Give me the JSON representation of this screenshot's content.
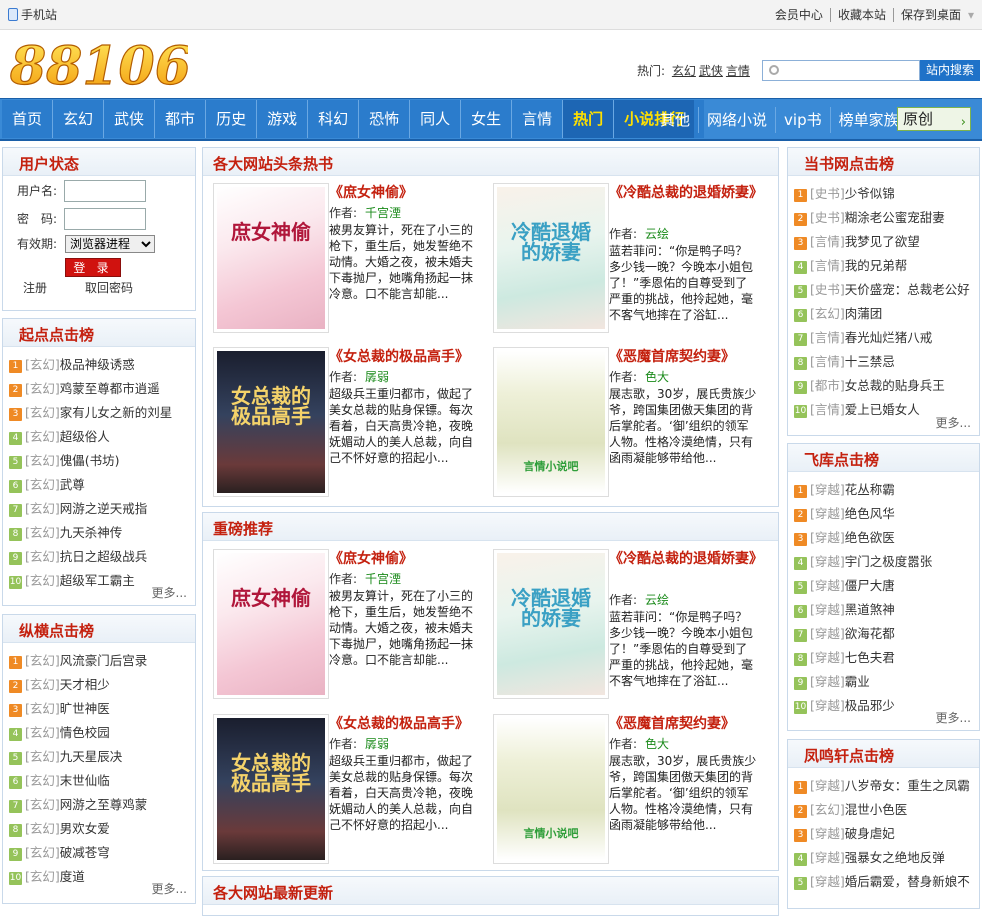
{
  "topbar": {
    "mobile": "手机站",
    "links": [
      "会员中心",
      "收藏本站",
      "保存到桌面"
    ]
  },
  "header": {
    "logo_text": "88106",
    "hot_label": "热门:",
    "hot_links": [
      "玄幻",
      "武侠",
      "言情"
    ],
    "search_placeholder": "",
    "search_button": "站内搜索"
  },
  "nav": {
    "main": [
      "首页",
      "玄幻",
      "武侠",
      "都市",
      "历史",
      "游戏",
      "科幻",
      "恐怖",
      "同人",
      "女生",
      "言情",
      "热门",
      "小说排行"
    ],
    "secondary": [
      "其他",
      "网络小说",
      "vip书",
      "榜单家族"
    ],
    "original": "原创"
  },
  "login": {
    "title": "用户状态",
    "user_label": "用户名:",
    "pass_label": "密　码:",
    "valid_label": "有效期:",
    "valid_value": "浏览器进程",
    "login_button": "登 录",
    "register": "注册",
    "recover": "取回密码"
  },
  "left_ranks": [
    {
      "title": "起点点击榜",
      "more": "更多...",
      "items": [
        {
          "cat": "[玄幻]",
          "name": "极品神级诱惑"
        },
        {
          "cat": "[玄幻]",
          "name": "鸡蒙至尊都市逍遥"
        },
        {
          "cat": "[玄幻]",
          "name": "家有儿女之新的刘星"
        },
        {
          "cat": "[玄幻]",
          "name": "超级俗人"
        },
        {
          "cat": "[玄幻]",
          "name": "傀儡(书坊)"
        },
        {
          "cat": "[玄幻]",
          "name": "武尊"
        },
        {
          "cat": "[玄幻]",
          "name": "网游之逆天戒指"
        },
        {
          "cat": "[玄幻]",
          "name": "九天杀神传"
        },
        {
          "cat": "[玄幻]",
          "name": "抗日之超级战兵"
        },
        {
          "cat": "[玄幻]",
          "name": "超级军工霸主"
        }
      ]
    },
    {
      "title": "纵横点击榜",
      "more": "更多...",
      "items": [
        {
          "cat": "[玄幻]",
          "name": "风流豪门后宫录"
        },
        {
          "cat": "[玄幻]",
          "name": "天才相少"
        },
        {
          "cat": "[玄幻]",
          "name": "旷世神医"
        },
        {
          "cat": "[玄幻]",
          "name": "情色校园"
        },
        {
          "cat": "[玄幻]",
          "name": "九天星辰决"
        },
        {
          "cat": "[玄幻]",
          "name": "末世仙临"
        },
        {
          "cat": "[玄幻]",
          "name": "网游之至尊鸡蒙"
        },
        {
          "cat": "[玄幻]",
          "name": "男欢女爱"
        },
        {
          "cat": "[玄幻]",
          "name": "破减苍穹"
        },
        {
          "cat": "[玄幻]",
          "name": "度道"
        }
      ]
    }
  ],
  "right_ranks": [
    {
      "title": "当书网点击榜",
      "more": "更多...",
      "items": [
        {
          "cat": "[史书]",
          "name": "少爷似锦"
        },
        {
          "cat": "[史书]",
          "name": "糊涂老公蜜宠甜妻"
        },
        {
          "cat": "[言情]",
          "name": "我梦见了欲望"
        },
        {
          "cat": "[言情]",
          "name": "我的兄弟帮"
        },
        {
          "cat": "[史书]",
          "name": "天价盛宠：总裁老公好"
        },
        {
          "cat": "[玄幻]",
          "name": "肉蒲团"
        },
        {
          "cat": "[言情]",
          "name": "春光灿烂猪八戒"
        },
        {
          "cat": "[言情]",
          "name": "十三禁忌"
        },
        {
          "cat": "[都市]",
          "name": "女总裁的贴身兵王"
        },
        {
          "cat": "[言情]",
          "name": "爱上已婚女人"
        }
      ]
    },
    {
      "title": "飞库点击榜",
      "more": "更多...",
      "items": [
        {
          "cat": "[穿越]",
          "name": "花丛称霸"
        },
        {
          "cat": "[穿越]",
          "name": "绝色风华"
        },
        {
          "cat": "[穿越]",
          "name": "绝色欲医"
        },
        {
          "cat": "[穿越]",
          "name": "宇门之极度嚣张"
        },
        {
          "cat": "[穿越]",
          "name": "僵尸大唐"
        },
        {
          "cat": "[穿越]",
          "name": "黑道煞神"
        },
        {
          "cat": "[穿越]",
          "name": "欲海花都"
        },
        {
          "cat": "[穿越]",
          "name": "七色夫君"
        },
        {
          "cat": "[穿越]",
          "name": "霸业"
        },
        {
          "cat": "[穿越]",
          "name": "极品邪少"
        }
      ]
    },
    {
      "title": "凤鸣轩点击榜",
      "more": "",
      "items": [
        {
          "cat": "[穿越]",
          "name": "八岁帝女：重生之凤霸"
        },
        {
          "cat": "[玄幻]",
          "name": "混世小色医"
        },
        {
          "cat": "[穿越]",
          "name": "破身虐妃"
        },
        {
          "cat": "[穿越]",
          "name": "强暴女之绝地反弹"
        },
        {
          "cat": "[穿越]",
          "name": "婚后霸爱，替身新娘不"
        }
      ]
    }
  ],
  "panels": [
    {
      "title": "各大网站头条热书"
    },
    {
      "title": "重磅推荐"
    },
    {
      "title": "各大网站最新更新"
    }
  ],
  "author_label": "作者:",
  "books": [
    {
      "title": "《庶女神偷》",
      "author": "千宫湮",
      "desc": "被男友算计，死在了小三的枪下，重生后，她发誓绝不动情。大婚之夜，被未婚夫下毒抛尸，她嘴角扬起一抹冷意。口不能言却能...",
      "cover_text": "庶女神偷"
    },
    {
      "title": "《冷酷总裁的退婚娇妻》",
      "author": "云绘",
      "desc": "蓝若菲问：“你是鸭子吗？多少钱一晚？今晚本小姐包了！”季恩佑的自尊受到了严重的挑战，他拎起她，毫不客气地摔在了浴缸...",
      "cover_text": "冷酷退婚的娇妻"
    },
    {
      "title": "《女总裁的极品高手》",
      "author": "孱弱",
      "desc": "超级兵王重归都市，做起了美女总裁的贴身保镖。每次看着，白天高贵冷艳，夜晚妩媚动人的美人总裁，向自己不怀好意的招起小...",
      "cover_text": "女总裁的极品高手"
    },
    {
      "title": "《恶魔首席契约妻》",
      "author": "色大",
      "desc": "展志歌，30岁，展氏贵族少爷，跨国集团傲天集团的背后掌舵者。‘御’组织的领军人物。性格冷漠绝情，只有函雨凝能够带给他...",
      "cover_text": "言情小说吧"
    }
  ]
}
